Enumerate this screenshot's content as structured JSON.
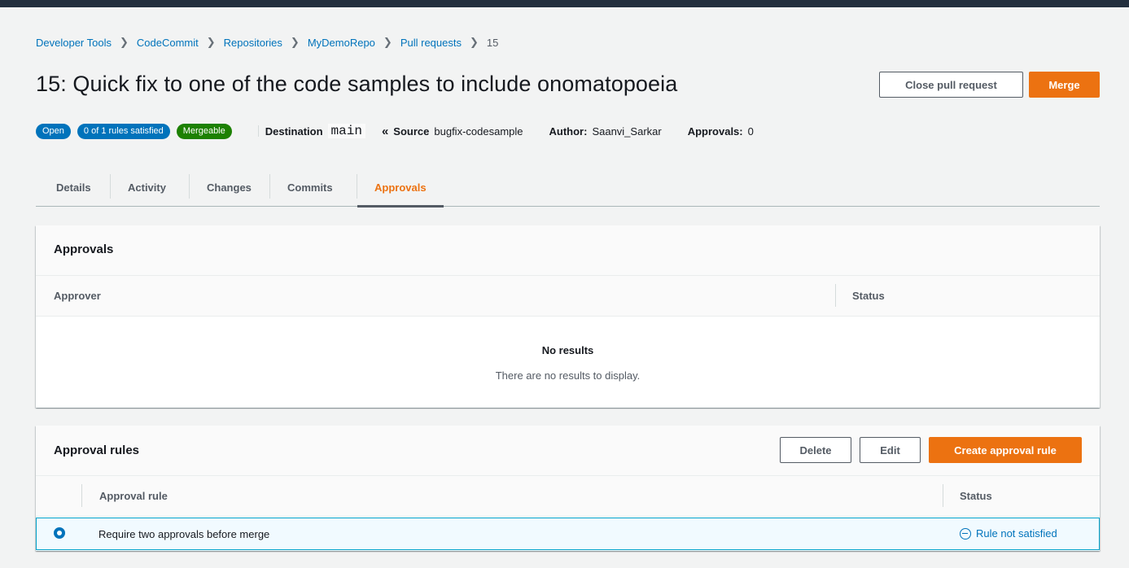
{
  "breadcrumb": {
    "items": [
      "Developer Tools",
      "CodeCommit",
      "Repositories",
      "MyDemoRepo",
      "Pull requests",
      "15"
    ]
  },
  "title": "15: Quick fix to one of the code samples to include onomatopoeia",
  "header_actions": {
    "close_label": "Close pull request",
    "merge_label": "Merge"
  },
  "badges": {
    "status": "Open",
    "rules": "0 of 1 rules satisfied",
    "merge": "Mergeable"
  },
  "meta": {
    "destination_label": "Destination",
    "destination_value": "main",
    "source_label": "Source",
    "source_value": "bugfix-codesample",
    "author_label": "Author:",
    "author_value": "Saanvi_Sarkar",
    "approvals_label": "Approvals:",
    "approvals_value": "0"
  },
  "tabs": [
    {
      "label": "Details",
      "active": false
    },
    {
      "label": "Activity",
      "active": false
    },
    {
      "label": "Changes",
      "active": false
    },
    {
      "label": "Commits",
      "active": false
    },
    {
      "label": "Approvals",
      "active": true
    }
  ],
  "approvals_panel": {
    "title": "Approvals",
    "columns": [
      "Approver",
      "Status"
    ],
    "empty_title": "No results",
    "empty_desc": "There are no results to display."
  },
  "rules_panel": {
    "title": "Approval rules",
    "delete_label": "Delete",
    "edit_label": "Edit",
    "create_label": "Create approval rule",
    "columns": [
      "Approval rule",
      "Status"
    ],
    "rows": [
      {
        "rule": "Require two approvals before merge",
        "status": "Rule not satisfied",
        "selected": true
      }
    ]
  },
  "colors": {
    "accent": "#ec7211",
    "link": "#0073bb",
    "success": "#1d8102"
  }
}
